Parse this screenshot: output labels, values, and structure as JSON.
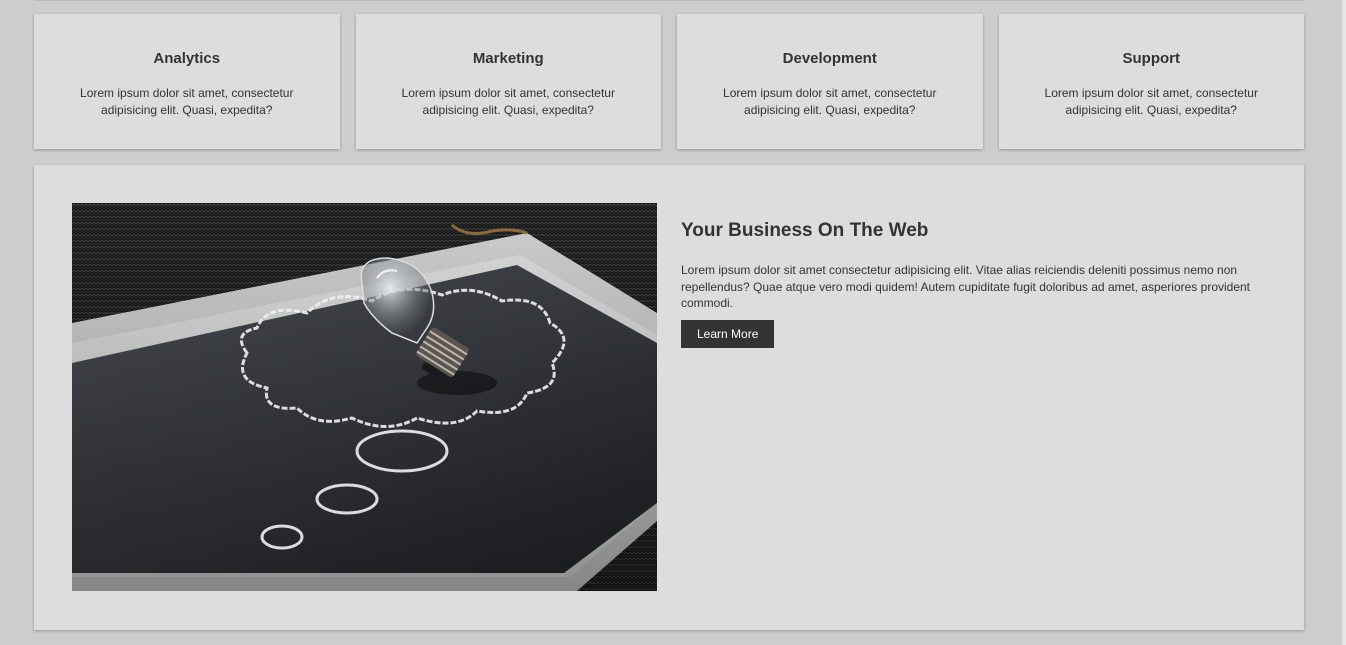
{
  "services": [
    {
      "title": "Analytics",
      "text": "Lorem ipsum dolor sit amet, consectetur adipisicing elit. Quasi, expedita?"
    },
    {
      "title": "Marketing",
      "text": "Lorem ipsum dolor sit amet, consectetur adipisicing elit. Quasi, expedita?"
    },
    {
      "title": "Development",
      "text": "Lorem ipsum dolor sit amet, consectetur adipisicing elit. Quasi, expedita?"
    },
    {
      "title": "Support",
      "text": "Lorem ipsum dolor sit amet, consectetur adipisicing elit. Quasi, expedita?"
    }
  ],
  "feature": {
    "title": "Your Business On The Web",
    "text": "Lorem ipsum dolor sit amet consectetur adipisicing elit. Vitae alias reiciendis deleniti possimus nemo non repellendus? Quae atque vero modi quidem! Autem cupiditate fugit doloribus ad amet, asperiores provident commodi.",
    "button_label": "Learn More",
    "image_icon": "lightbulb-chalkboard-image"
  },
  "colors": {
    "background": "#cdcdcd",
    "card": "#dddddd",
    "text": "#333333",
    "button": "#333333",
    "button_text": "#ffffff"
  }
}
